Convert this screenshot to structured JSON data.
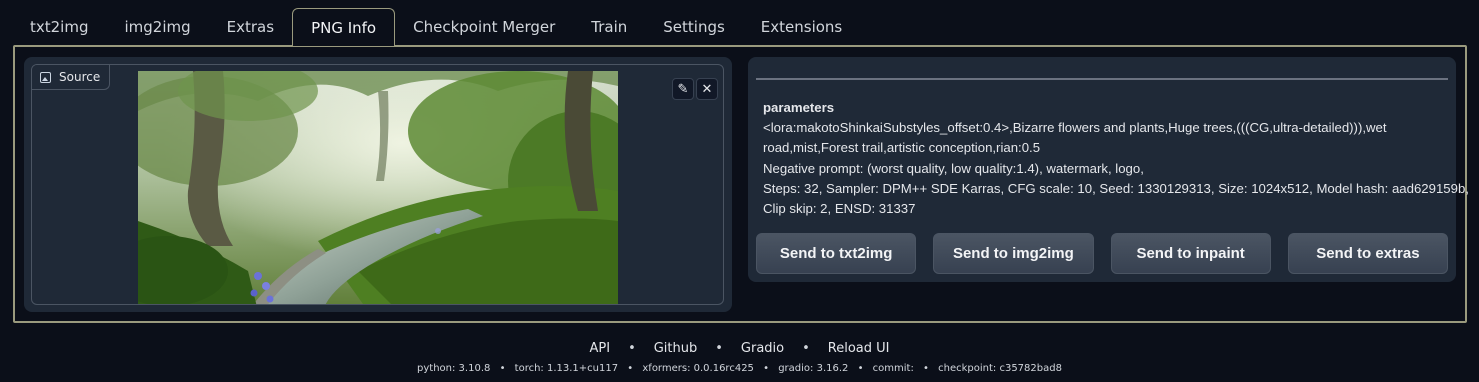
{
  "tabs": [
    {
      "label": "txt2img"
    },
    {
      "label": "img2img"
    },
    {
      "label": "Extras"
    },
    {
      "label": "PNG Info",
      "active": true
    },
    {
      "label": "Checkpoint Merger"
    },
    {
      "label": "Train"
    },
    {
      "label": "Settings"
    },
    {
      "label": "Extensions"
    }
  ],
  "source": {
    "label": "Source",
    "icon": "image-icon",
    "edit_icon": "pencil-icon",
    "close_icon": "close-icon"
  },
  "info": {
    "title": "parameters",
    "lines": [
      "<lora:makotoShinkaiSubstyles_offset:0.4>,Bizarre flowers and plants,Huge trees,(((CG,ultra-detailed))),wet",
      "road,mist,Forest trail,artistic conception,rian:0.5",
      "Negative prompt: (worst quality, low quality:1.4), watermark, logo,",
      "Steps: 32, Sampler: DPM++ SDE Karras, CFG scale: 10, Seed: 1330129313, Size: 1024x512, Model hash: aad629159b,",
      "Clip skip: 2, ENSD: 31337"
    ]
  },
  "buttons": {
    "send_txt2img": "Send to txt2img",
    "send_img2img": "Send to img2img",
    "send_inpaint": "Send to inpaint",
    "send_extras": "Send to extras"
  },
  "footer": {
    "links": [
      "API",
      "Github",
      "Gradio",
      "Reload UI"
    ],
    "separator": "•",
    "versions": [
      "python: 3.10.8",
      "torch: 1.13.1+cu117",
      "xformers: 0.0.16rc425",
      "gradio: 3.16.2",
      "commit:",
      "checkpoint: c35782bad8"
    ]
  },
  "colors": {
    "background": "#0b0f19",
    "panel": "#1f2937",
    "accent_border": "#9a9a7e"
  }
}
